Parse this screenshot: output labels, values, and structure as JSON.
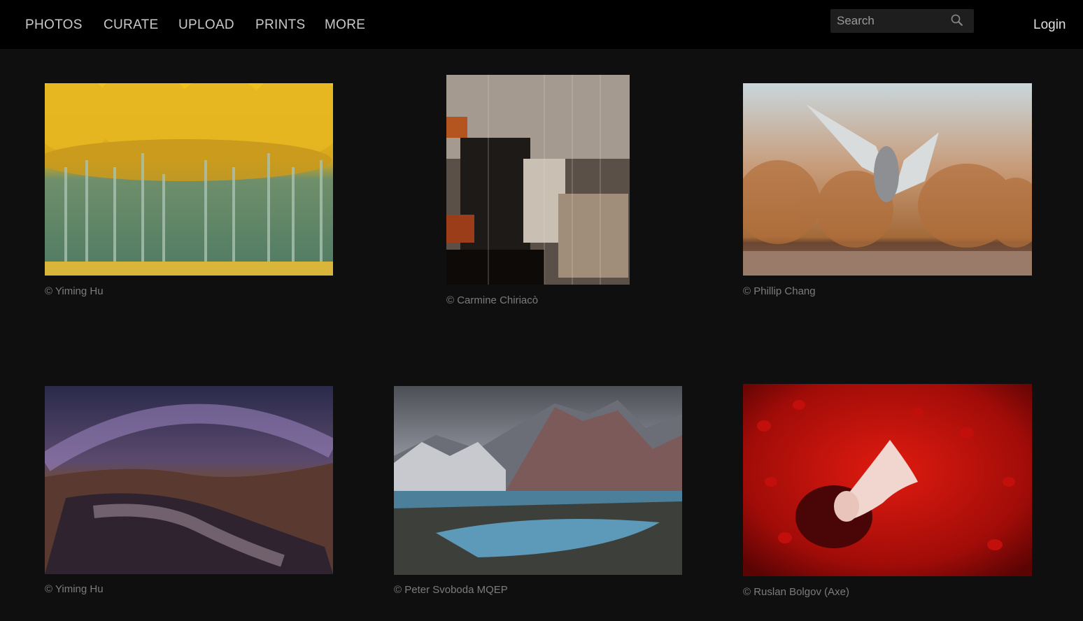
{
  "nav": {
    "items": [
      "PHOTOS",
      "CURATE",
      "UPLOAD",
      "PRINTS",
      "MORE"
    ],
    "login": "Login"
  },
  "search": {
    "placeholder": "Search",
    "value": ""
  },
  "gallery": [
    {
      "credit": "© Yiming Hu",
      "subject": "yellow-poplar-forest"
    },
    {
      "credit": "© Carmine Chiriacò",
      "subject": "abstract-city-skyline"
    },
    {
      "credit": "© Phillip Chang",
      "subject": "cranes-dancing"
    },
    {
      "credit": "© Yiming Hu",
      "subject": "milky-way-canyon"
    },
    {
      "credit": "© Peter Svoboda MQEP",
      "subject": "patagonia-mountains-lake"
    },
    {
      "credit": "© Ruslan Bolgov (Axe)",
      "subject": "woman-red-petals"
    }
  ],
  "colors": {
    "nav_bg": "#000000",
    "page_bg": "#0f0f0f",
    "search_bg": "#1e1e1e"
  }
}
